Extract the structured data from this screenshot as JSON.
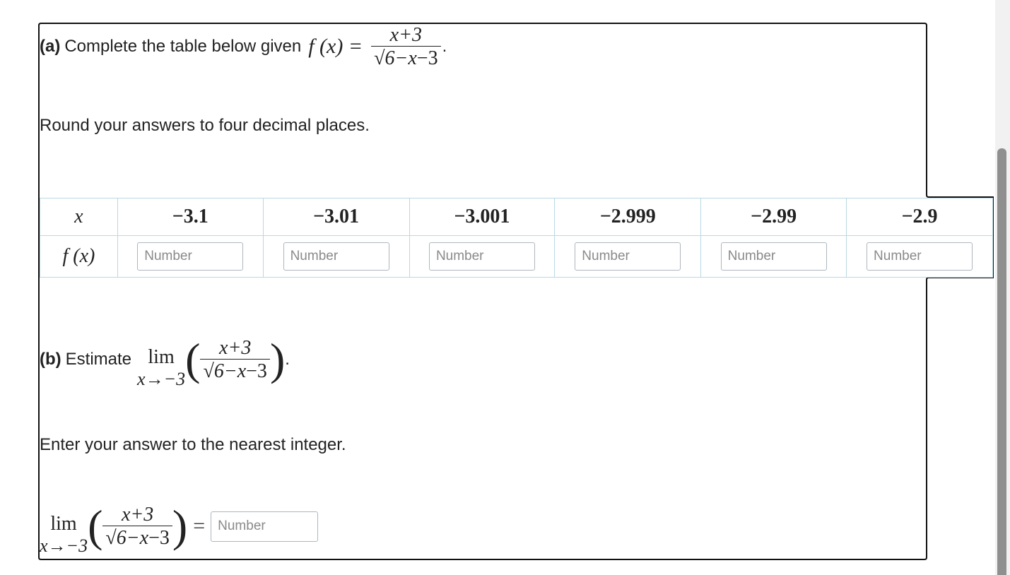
{
  "part_a": {
    "label": "(a)",
    "text": "Complete the table below given",
    "func": "f (x) =",
    "numerator": "x+3",
    "radicand": "6−x",
    "den_tail": "−3",
    "period": ".",
    "round_note": "Round your answers to four decimal places."
  },
  "table": {
    "header_label": "x",
    "row_label": "f (x)",
    "x_values": [
      "−3.1",
      "−3.01",
      "−3.001",
      "−2.999",
      "−2.99",
      "−2.9"
    ],
    "placeholder": "Number",
    "inputs": [
      "",
      "",
      "",
      "",
      "",
      ""
    ]
  },
  "part_b": {
    "label": "(b)",
    "text": "Estimate",
    "lim": "lim",
    "approach": "x→−3",
    "numerator": "x+3",
    "radicand": "6−x",
    "den_tail": "−3",
    "period": ".",
    "note": "Enter your answer to the nearest integer.",
    "equals": "=",
    "answer_placeholder": "Number",
    "answer_value": ""
  }
}
